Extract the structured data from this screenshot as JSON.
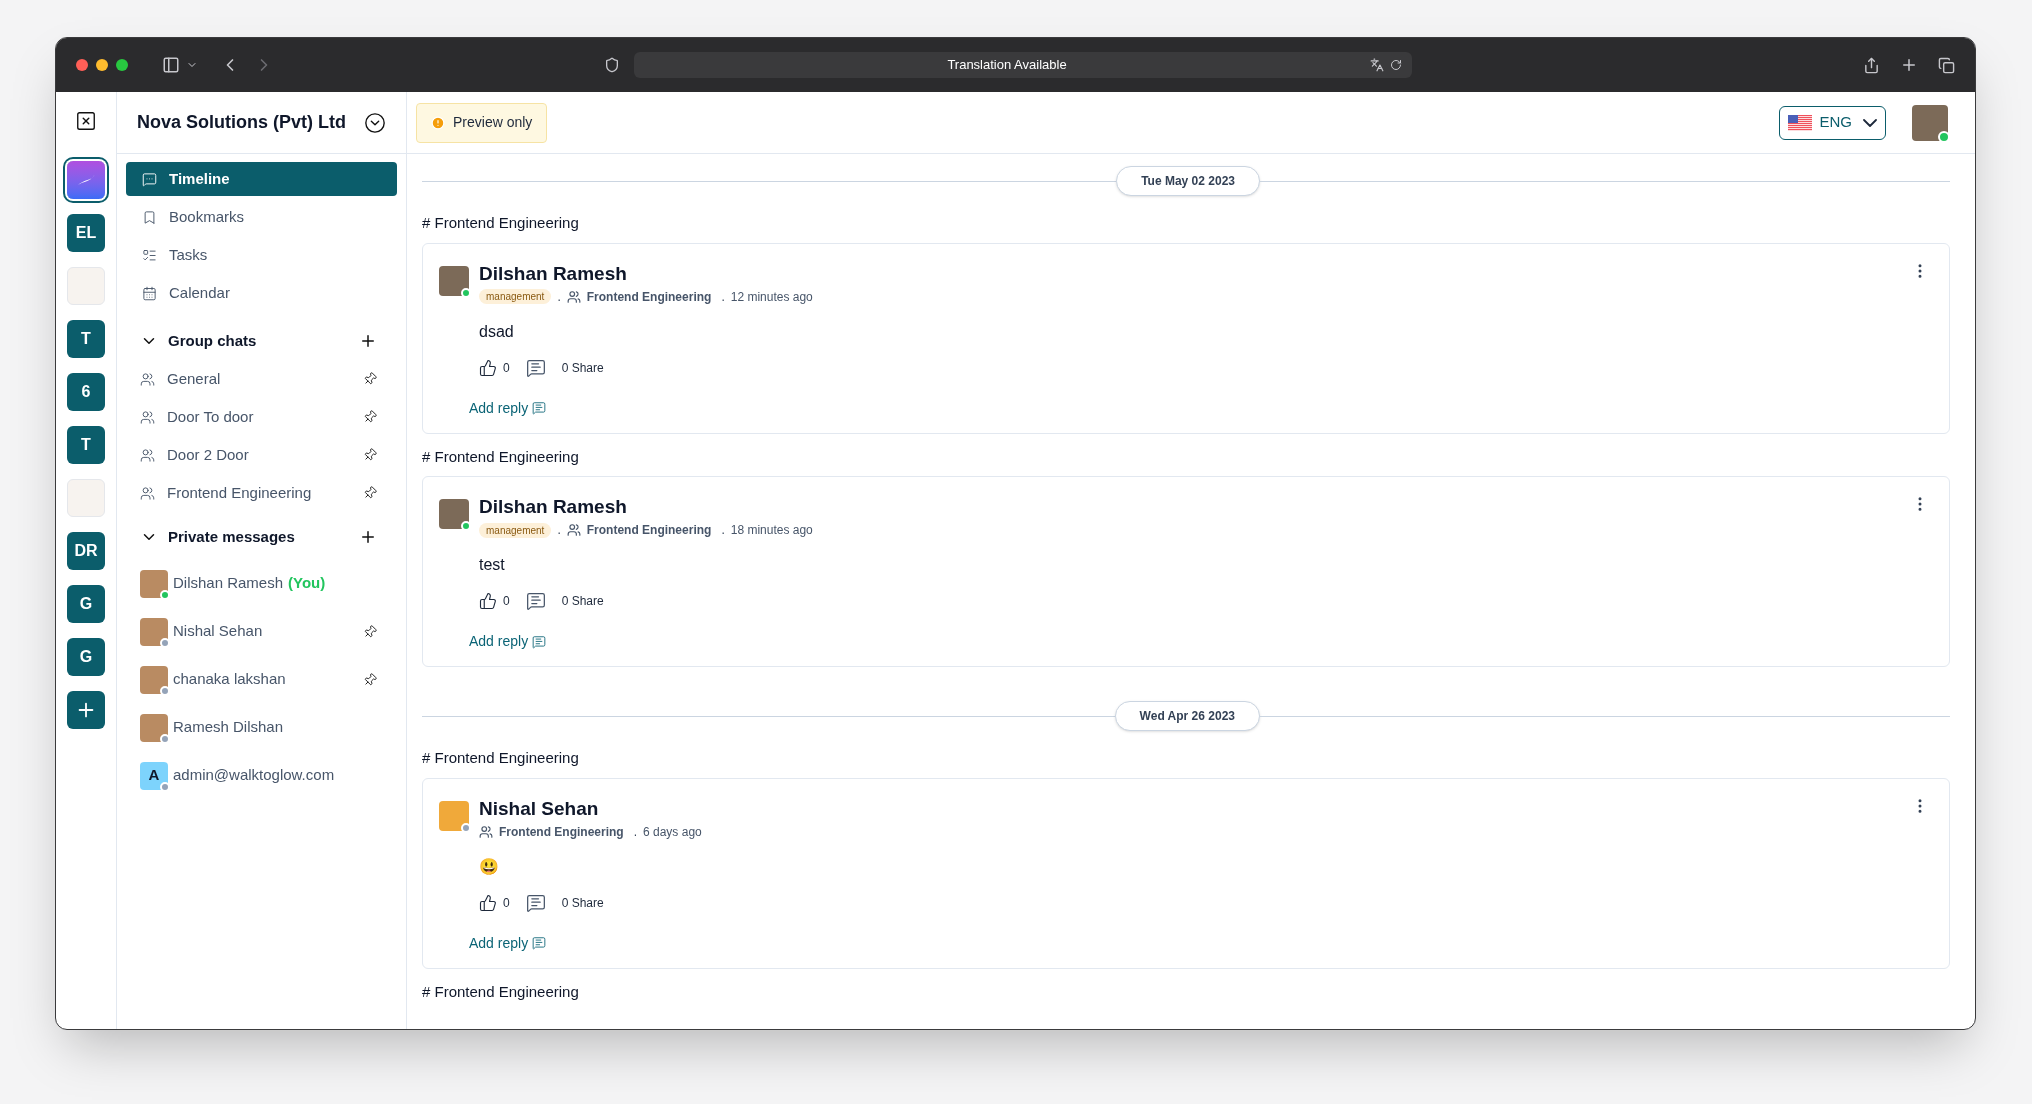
{
  "browser": {
    "address": "Translation Available"
  },
  "rail": {
    "items": [
      {
        "kind": "logo",
        "selected": true
      },
      {
        "kind": "initials",
        "label": "EL",
        "selected": false
      },
      {
        "kind": "image",
        "selected": false
      },
      {
        "kind": "initials",
        "label": "T",
        "selected": false
      },
      {
        "kind": "initials",
        "label": "6",
        "selected": false
      },
      {
        "kind": "initials",
        "label": "T",
        "selected": false
      },
      {
        "kind": "image",
        "selected": false
      },
      {
        "kind": "initials",
        "label": "DR",
        "selected": false
      },
      {
        "kind": "initials",
        "label": "G",
        "selected": false
      },
      {
        "kind": "initials",
        "label": "G",
        "selected": false
      },
      {
        "kind": "add",
        "selected": false
      }
    ]
  },
  "sidebar": {
    "org_name": "Nova Solutions (Pvt) Ltd",
    "nav": [
      {
        "label": "Timeline",
        "selected": true
      },
      {
        "label": "Bookmarks",
        "selected": false
      },
      {
        "label": "Tasks",
        "selected": false
      },
      {
        "label": "Calendar",
        "selected": false
      }
    ],
    "group_chats": {
      "title": "Group chats",
      "expanded": true,
      "items": [
        {
          "label": "General",
          "pinned": true
        },
        {
          "label": "Door To door",
          "pinned": true
        },
        {
          "label": "Door 2 Door",
          "pinned": true
        },
        {
          "label": "Frontend Engineering",
          "pinned": true
        }
      ]
    },
    "private_messages": {
      "title": "Private messages",
      "expanded": true,
      "items": [
        {
          "name": "Dilshan Ramesh",
          "you": "(You)",
          "kind": "photo",
          "online": true,
          "pinned": false
        },
        {
          "name": "Nishal Sehan",
          "kind": "photo",
          "online": false,
          "pinned": true
        },
        {
          "name": "chanaka lakshan",
          "kind": "photo",
          "online": false,
          "pinned": true
        },
        {
          "name": "Ramesh Dilshan",
          "kind": "photo",
          "online": false,
          "pinned": false
        },
        {
          "name": "admin@walktoglow.com",
          "kind": "letter",
          "letter": "A",
          "online": false,
          "pinned": false
        }
      ]
    }
  },
  "header": {
    "notice": "Preview only",
    "language": "ENG",
    "user_online": true
  },
  "feed": [
    {
      "kind": "date",
      "label": "Tue May 02 2023"
    },
    {
      "kind": "channel",
      "label": "# Frontend Engineering"
    },
    {
      "kind": "post",
      "author": "Dilshan Ramesh",
      "online": true,
      "tag": "management",
      "separator": ".",
      "group": "Frontend Engineering",
      "time_separator": ".",
      "time": "12 minutes ago",
      "body": "dsad",
      "likes": "0",
      "share": "0 Share",
      "reply": "Add reply"
    },
    {
      "kind": "channel",
      "label": "# Frontend Engineering"
    },
    {
      "kind": "post",
      "author": "Dilshan Ramesh",
      "online": true,
      "tag": "management",
      "separator": ".",
      "group": "Frontend Engineering",
      "time_separator": ".",
      "time": "18 minutes ago",
      "body": "test",
      "likes": "0",
      "share": "0 Share",
      "reply": "Add reply"
    },
    {
      "kind": "date",
      "label": "Wed Apr 26 2023"
    },
    {
      "kind": "channel",
      "label": "# Frontend Engineering"
    },
    {
      "kind": "post",
      "author": "Nishal Sehan",
      "online": false,
      "group": "Frontend Engineering",
      "time_separator": ".",
      "time": "6 days ago",
      "body": "😃",
      "likes": "0",
      "share": "0 Share",
      "reply": "Add reply"
    },
    {
      "kind": "channel",
      "label": "# Frontend Engineering"
    }
  ]
}
